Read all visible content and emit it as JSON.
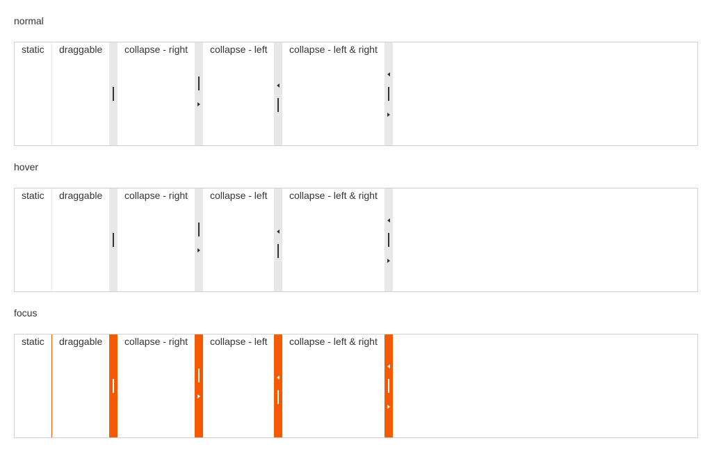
{
  "colors": {
    "focus_accent": "#f55a03",
    "bar_default": "#e8e8e8",
    "frame_border": "#cfcfcf"
  },
  "panes": {
    "static": "static",
    "draggable": "draggable",
    "collapse_right": "collapse - right",
    "collapse_left": "collapse - left",
    "collapse_both": "collapse - left & right"
  },
  "sections": [
    {
      "label": "normal"
    },
    {
      "label": "hover"
    },
    {
      "label": "focus"
    }
  ]
}
